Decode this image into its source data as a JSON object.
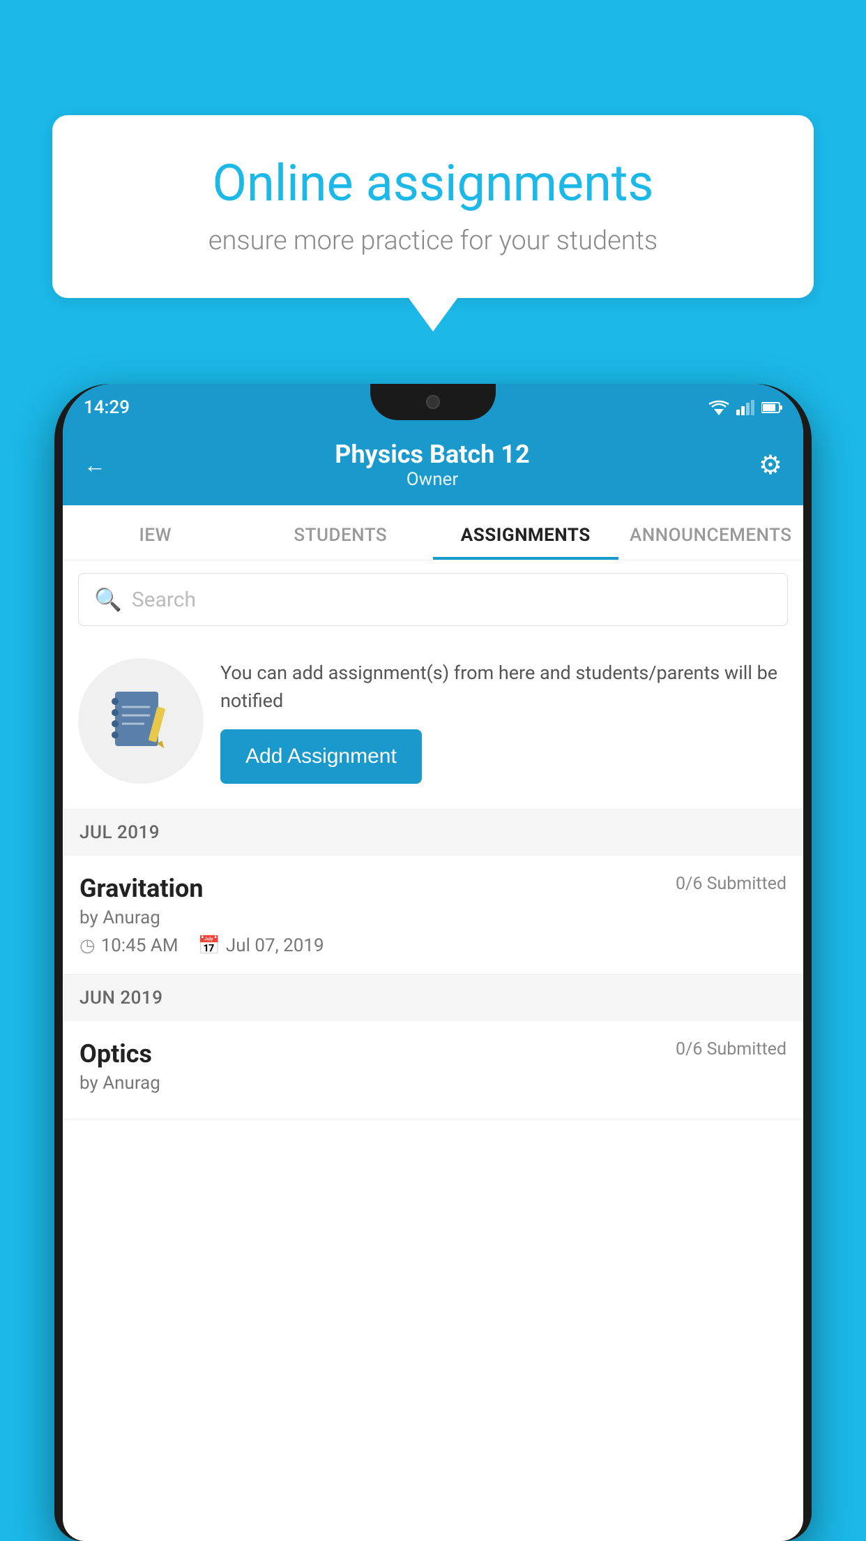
{
  "background_color": "#1bb8e8",
  "speech_bubble": {
    "title": "Online assignments",
    "subtitle": "ensure more practice for your students"
  },
  "status_bar": {
    "time": "14:29"
  },
  "header": {
    "title": "Physics Batch 12",
    "subtitle": "Owner"
  },
  "tabs": [
    {
      "label": "IEW",
      "active": false
    },
    {
      "label": "STUDENTS",
      "active": false
    },
    {
      "label": "ASSIGNMENTS",
      "active": true
    },
    {
      "label": "ANNOUNCEMENTS",
      "active": false
    }
  ],
  "search": {
    "placeholder": "Search"
  },
  "info_card": {
    "description": "You can add assignment(s) from here and students/parents will be notified",
    "button_label": "Add Assignment"
  },
  "sections": [
    {
      "month_label": "JUL 2019",
      "assignments": [
        {
          "title": "Gravitation",
          "submitted": "0/6 Submitted",
          "by": "by Anurag",
          "time": "10:45 AM",
          "date": "Jul 07, 2019"
        }
      ]
    },
    {
      "month_label": "JUN 2019",
      "assignments": [
        {
          "title": "Optics",
          "submitted": "0/6 Submitted",
          "by": "by Anurag",
          "time": "",
          "date": ""
        }
      ]
    }
  ]
}
